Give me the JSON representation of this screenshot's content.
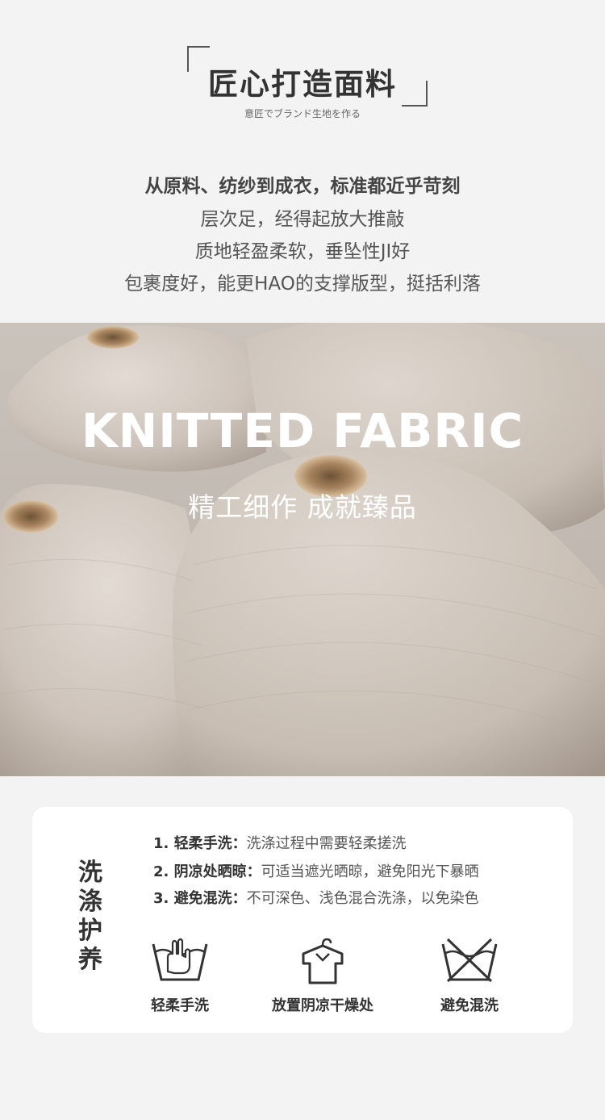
{
  "header": {
    "title": "匠心打造面料",
    "subtitle": "意匠でブランド生地を作る"
  },
  "description": {
    "lines": [
      "从原料、纺纱到成衣，标准都近乎苛刻",
      "层次足，经得起放大推敲",
      "质地轻盈柔软，垂坠性JI好",
      "包裹度好，能更HAO的支撑版型，挺括利落"
    ]
  },
  "photo": {
    "title": "KNITTED FABRIC",
    "subtitle": "精工细作 成就臻品"
  },
  "care": {
    "heading": [
      "洗",
      "涤",
      "护",
      "养"
    ],
    "rules": [
      {
        "label": "1. 轻柔手洗：",
        "text": "洗涤过程中需要轻柔搓洗"
      },
      {
        "label": "2. 阴凉处晒晾：",
        "text": "可适当遮光晒晾，避免阳光下暴晒"
      },
      {
        "label": "3. 避免混洗：",
        "text": "不可深色、浅色混合洗涤，以免染色"
      }
    ],
    "icons": [
      {
        "icon": "hand-wash-icon",
        "label": "轻柔手洗"
      },
      {
        "icon": "hanging-shirt-icon",
        "label": "放置阴凉干燥处"
      },
      {
        "icon": "no-wash-icon",
        "label": "避免混洗"
      }
    ]
  }
}
